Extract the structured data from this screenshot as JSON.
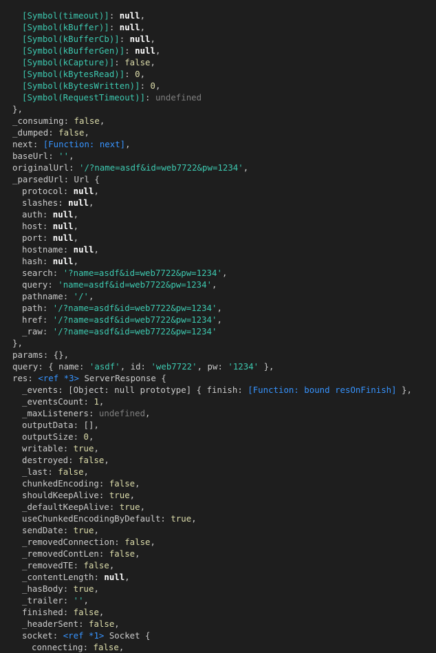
{
  "lines": [
    {
      "indent": 1,
      "tokens": [
        [
          "sym",
          "[Symbol(timeout)]"
        ],
        [
          "punct",
          ": "
        ],
        [
          "null",
          "null"
        ],
        [
          "punct",
          ","
        ]
      ]
    },
    {
      "indent": 1,
      "tokens": [
        [
          "sym",
          "[Symbol(kBuffer)]"
        ],
        [
          "punct",
          ": "
        ],
        [
          "null",
          "null"
        ],
        [
          "punct",
          ","
        ]
      ]
    },
    {
      "indent": 1,
      "tokens": [
        [
          "sym",
          "[Symbol(kBufferCb)]"
        ],
        [
          "punct",
          ": "
        ],
        [
          "null",
          "null"
        ],
        [
          "punct",
          ","
        ]
      ]
    },
    {
      "indent": 1,
      "tokens": [
        [
          "sym",
          "[Symbol(kBufferGen)]"
        ],
        [
          "punct",
          ": "
        ],
        [
          "null",
          "null"
        ],
        [
          "punct",
          ","
        ]
      ]
    },
    {
      "indent": 1,
      "tokens": [
        [
          "sym",
          "[Symbol(kCapture)]"
        ],
        [
          "punct",
          ": "
        ],
        [
          "bool",
          "false"
        ],
        [
          "punct",
          ","
        ]
      ]
    },
    {
      "indent": 1,
      "tokens": [
        [
          "sym",
          "[Symbol(kBytesRead)]"
        ],
        [
          "punct",
          ": "
        ],
        [
          "num",
          "0"
        ],
        [
          "punct",
          ","
        ]
      ]
    },
    {
      "indent": 1,
      "tokens": [
        [
          "sym",
          "[Symbol(kBytesWritten)]"
        ],
        [
          "punct",
          ": "
        ],
        [
          "num",
          "0"
        ],
        [
          "punct",
          ","
        ]
      ]
    },
    {
      "indent": 1,
      "tokens": [
        [
          "sym",
          "[Symbol(RequestTimeout)]"
        ],
        [
          "punct",
          ": "
        ],
        [
          "undef",
          "undefined"
        ]
      ]
    },
    {
      "indent": 0,
      "tokens": [
        [
          "punct",
          "},"
        ]
      ]
    },
    {
      "indent": 0,
      "tokens": [
        [
          "key",
          "_consuming"
        ],
        [
          "punct",
          ": "
        ],
        [
          "bool",
          "false"
        ],
        [
          "punct",
          ","
        ]
      ]
    },
    {
      "indent": 0,
      "tokens": [
        [
          "key",
          "_dumped"
        ],
        [
          "punct",
          ": "
        ],
        [
          "bool",
          "false"
        ],
        [
          "punct",
          ","
        ]
      ]
    },
    {
      "indent": 0,
      "tokens": [
        [
          "key",
          "next"
        ],
        [
          "punct",
          ": "
        ],
        [
          "func",
          "[Function: next]"
        ],
        [
          "punct",
          ","
        ]
      ]
    },
    {
      "indent": 0,
      "tokens": [
        [
          "key",
          "baseUrl"
        ],
        [
          "punct",
          ": "
        ],
        [
          "str",
          "''"
        ],
        [
          "punct",
          ","
        ]
      ]
    },
    {
      "indent": 0,
      "tokens": [
        [
          "key",
          "originalUrl"
        ],
        [
          "punct",
          ": "
        ],
        [
          "str",
          "'/?name=asdf&id=web7722&pw=1234'"
        ],
        [
          "punct",
          ","
        ]
      ]
    },
    {
      "indent": 0,
      "tokens": [
        [
          "key",
          "_parsedUrl"
        ],
        [
          "punct",
          ": "
        ],
        [
          "class",
          "Url {"
        ]
      ]
    },
    {
      "indent": 1,
      "tokens": [
        [
          "key",
          "protocol"
        ],
        [
          "punct",
          ": "
        ],
        [
          "null",
          "null"
        ],
        [
          "punct",
          ","
        ]
      ]
    },
    {
      "indent": 1,
      "tokens": [
        [
          "key",
          "slashes"
        ],
        [
          "punct",
          ": "
        ],
        [
          "null",
          "null"
        ],
        [
          "punct",
          ","
        ]
      ]
    },
    {
      "indent": 1,
      "tokens": [
        [
          "key",
          "auth"
        ],
        [
          "punct",
          ": "
        ],
        [
          "null",
          "null"
        ],
        [
          "punct",
          ","
        ]
      ]
    },
    {
      "indent": 1,
      "tokens": [
        [
          "key",
          "host"
        ],
        [
          "punct",
          ": "
        ],
        [
          "null",
          "null"
        ],
        [
          "punct",
          ","
        ]
      ]
    },
    {
      "indent": 1,
      "tokens": [
        [
          "key",
          "port"
        ],
        [
          "punct",
          ": "
        ],
        [
          "null",
          "null"
        ],
        [
          "punct",
          ","
        ]
      ]
    },
    {
      "indent": 1,
      "tokens": [
        [
          "key",
          "hostname"
        ],
        [
          "punct",
          ": "
        ],
        [
          "null",
          "null"
        ],
        [
          "punct",
          ","
        ]
      ]
    },
    {
      "indent": 1,
      "tokens": [
        [
          "key",
          "hash"
        ],
        [
          "punct",
          ": "
        ],
        [
          "null",
          "null"
        ],
        [
          "punct",
          ","
        ]
      ]
    },
    {
      "indent": 1,
      "tokens": [
        [
          "key",
          "search"
        ],
        [
          "punct",
          ": "
        ],
        [
          "str",
          "'?name=asdf&id=web7722&pw=1234'"
        ],
        [
          "punct",
          ","
        ]
      ]
    },
    {
      "indent": 1,
      "tokens": [
        [
          "key",
          "query"
        ],
        [
          "punct",
          ": "
        ],
        [
          "str",
          "'name=asdf&id=web7722&pw=1234'"
        ],
        [
          "punct",
          ","
        ]
      ]
    },
    {
      "indent": 1,
      "tokens": [
        [
          "key",
          "pathname"
        ],
        [
          "punct",
          ": "
        ],
        [
          "str",
          "'/'"
        ],
        [
          "punct",
          ","
        ]
      ]
    },
    {
      "indent": 1,
      "tokens": [
        [
          "key",
          "path"
        ],
        [
          "punct",
          ": "
        ],
        [
          "str",
          "'/?name=asdf&id=web7722&pw=1234'"
        ],
        [
          "punct",
          ","
        ]
      ]
    },
    {
      "indent": 1,
      "tokens": [
        [
          "key",
          "href"
        ],
        [
          "punct",
          ": "
        ],
        [
          "str",
          "'/?name=asdf&id=web7722&pw=1234'"
        ],
        [
          "punct",
          ","
        ]
      ]
    },
    {
      "indent": 1,
      "tokens": [
        [
          "key",
          "_raw"
        ],
        [
          "punct",
          ": "
        ],
        [
          "str",
          "'/?name=asdf&id=web7722&pw=1234'"
        ]
      ]
    },
    {
      "indent": 0,
      "tokens": [
        [
          "punct",
          "},"
        ]
      ]
    },
    {
      "indent": 0,
      "tokens": [
        [
          "key",
          "params"
        ],
        [
          "punct",
          ": {},"
        ]
      ]
    },
    {
      "indent": 0,
      "tokens": [
        [
          "key",
          "query"
        ],
        [
          "punct",
          ": { "
        ],
        [
          "key",
          "name"
        ],
        [
          "punct",
          ": "
        ],
        [
          "str",
          "'asdf'"
        ],
        [
          "punct",
          ", "
        ],
        [
          "key",
          "id"
        ],
        [
          "punct",
          ": "
        ],
        [
          "str",
          "'web7722'"
        ],
        [
          "punct",
          ", "
        ],
        [
          "key",
          "pw"
        ],
        [
          "punct",
          ": "
        ],
        [
          "str",
          "'1234'"
        ],
        [
          "punct",
          " },"
        ]
      ]
    },
    {
      "indent": 0,
      "tokens": [
        [
          "key",
          "res"
        ],
        [
          "punct",
          ": "
        ],
        [
          "ref",
          "<ref *3>"
        ],
        [
          "class",
          " ServerResponse {"
        ]
      ]
    },
    {
      "indent": 1,
      "tokens": [
        [
          "key",
          "_events"
        ],
        [
          "punct",
          ": [Object: null prototype] { "
        ],
        [
          "key",
          "finish"
        ],
        [
          "punct",
          ": "
        ],
        [
          "func",
          "[Function: bound resOnFinish]"
        ],
        [
          "punct",
          " },"
        ]
      ]
    },
    {
      "indent": 1,
      "tokens": [
        [
          "key",
          "_eventsCount"
        ],
        [
          "punct",
          ": "
        ],
        [
          "num",
          "1"
        ],
        [
          "punct",
          ","
        ]
      ]
    },
    {
      "indent": 1,
      "tokens": [
        [
          "key",
          "_maxListeners"
        ],
        [
          "punct",
          ": "
        ],
        [
          "undef",
          "undefined"
        ],
        [
          "punct",
          ","
        ]
      ]
    },
    {
      "indent": 1,
      "tokens": [
        [
          "key",
          "outputData"
        ],
        [
          "punct",
          ": [],"
        ]
      ]
    },
    {
      "indent": 1,
      "tokens": [
        [
          "key",
          "outputSize"
        ],
        [
          "punct",
          ": "
        ],
        [
          "num",
          "0"
        ],
        [
          "punct",
          ","
        ]
      ]
    },
    {
      "indent": 1,
      "tokens": [
        [
          "key",
          "writable"
        ],
        [
          "punct",
          ": "
        ],
        [
          "bool",
          "true"
        ],
        [
          "punct",
          ","
        ]
      ]
    },
    {
      "indent": 1,
      "tokens": [
        [
          "key",
          "destroyed"
        ],
        [
          "punct",
          ": "
        ],
        [
          "bool",
          "false"
        ],
        [
          "punct",
          ","
        ]
      ]
    },
    {
      "indent": 1,
      "tokens": [
        [
          "key",
          "_last"
        ],
        [
          "punct",
          ": "
        ],
        [
          "bool",
          "false"
        ],
        [
          "punct",
          ","
        ]
      ]
    },
    {
      "indent": 1,
      "tokens": [
        [
          "key",
          "chunkedEncoding"
        ],
        [
          "punct",
          ": "
        ],
        [
          "bool",
          "false"
        ],
        [
          "punct",
          ","
        ]
      ]
    },
    {
      "indent": 1,
      "tokens": [
        [
          "key",
          "shouldKeepAlive"
        ],
        [
          "punct",
          ": "
        ],
        [
          "bool",
          "true"
        ],
        [
          "punct",
          ","
        ]
      ]
    },
    {
      "indent": 1,
      "tokens": [
        [
          "key",
          "_defaultKeepAlive"
        ],
        [
          "punct",
          ": "
        ],
        [
          "bool",
          "true"
        ],
        [
          "punct",
          ","
        ]
      ]
    },
    {
      "indent": 1,
      "tokens": [
        [
          "key",
          "useChunkedEncodingByDefault"
        ],
        [
          "punct",
          ": "
        ],
        [
          "bool",
          "true"
        ],
        [
          "punct",
          ","
        ]
      ]
    },
    {
      "indent": 1,
      "tokens": [
        [
          "key",
          "sendDate"
        ],
        [
          "punct",
          ": "
        ],
        [
          "bool",
          "true"
        ],
        [
          "punct",
          ","
        ]
      ]
    },
    {
      "indent": 1,
      "tokens": [
        [
          "key",
          "_removedConnection"
        ],
        [
          "punct",
          ": "
        ],
        [
          "bool",
          "false"
        ],
        [
          "punct",
          ","
        ]
      ]
    },
    {
      "indent": 1,
      "tokens": [
        [
          "key",
          "_removedContLen"
        ],
        [
          "punct",
          ": "
        ],
        [
          "bool",
          "false"
        ],
        [
          "punct",
          ","
        ]
      ]
    },
    {
      "indent": 1,
      "tokens": [
        [
          "key",
          "_removedTE"
        ],
        [
          "punct",
          ": "
        ],
        [
          "bool",
          "false"
        ],
        [
          "punct",
          ","
        ]
      ]
    },
    {
      "indent": 1,
      "tokens": [
        [
          "key",
          "_contentLength"
        ],
        [
          "punct",
          ": "
        ],
        [
          "null",
          "null"
        ],
        [
          "punct",
          ","
        ]
      ]
    },
    {
      "indent": 1,
      "tokens": [
        [
          "key",
          "_hasBody"
        ],
        [
          "punct",
          ": "
        ],
        [
          "bool",
          "true"
        ],
        [
          "punct",
          ","
        ]
      ]
    },
    {
      "indent": 1,
      "tokens": [
        [
          "key",
          "_trailer"
        ],
        [
          "punct",
          ": "
        ],
        [
          "str",
          "''"
        ],
        [
          "punct",
          ","
        ]
      ]
    },
    {
      "indent": 1,
      "tokens": [
        [
          "key",
          "finished"
        ],
        [
          "punct",
          ": "
        ],
        [
          "bool",
          "false"
        ],
        [
          "punct",
          ","
        ]
      ]
    },
    {
      "indent": 1,
      "tokens": [
        [
          "key",
          "_headerSent"
        ],
        [
          "punct",
          ": "
        ],
        [
          "bool",
          "false"
        ],
        [
          "punct",
          ","
        ]
      ]
    },
    {
      "indent": 1,
      "tokens": [
        [
          "key",
          "socket"
        ],
        [
          "punct",
          ": "
        ],
        [
          "ref",
          "<ref *1>"
        ],
        [
          "class",
          " Socket {"
        ]
      ]
    },
    {
      "indent": 2,
      "tokens": [
        [
          "key",
          "connecting"
        ],
        [
          "punct",
          ": "
        ],
        [
          "bool",
          "false"
        ],
        [
          "punct",
          ","
        ]
      ]
    }
  ],
  "colors": {
    "background": "#1e1e1e",
    "text": "#cccccc",
    "symbol": "#3dc9b0",
    "null": "#ffffff",
    "boolean": "#dcdcaa",
    "number": "#dcdcaa",
    "undefined": "#808080",
    "function": "#3794ff",
    "string": "#3dc9b0",
    "reference": "#3794ff"
  }
}
